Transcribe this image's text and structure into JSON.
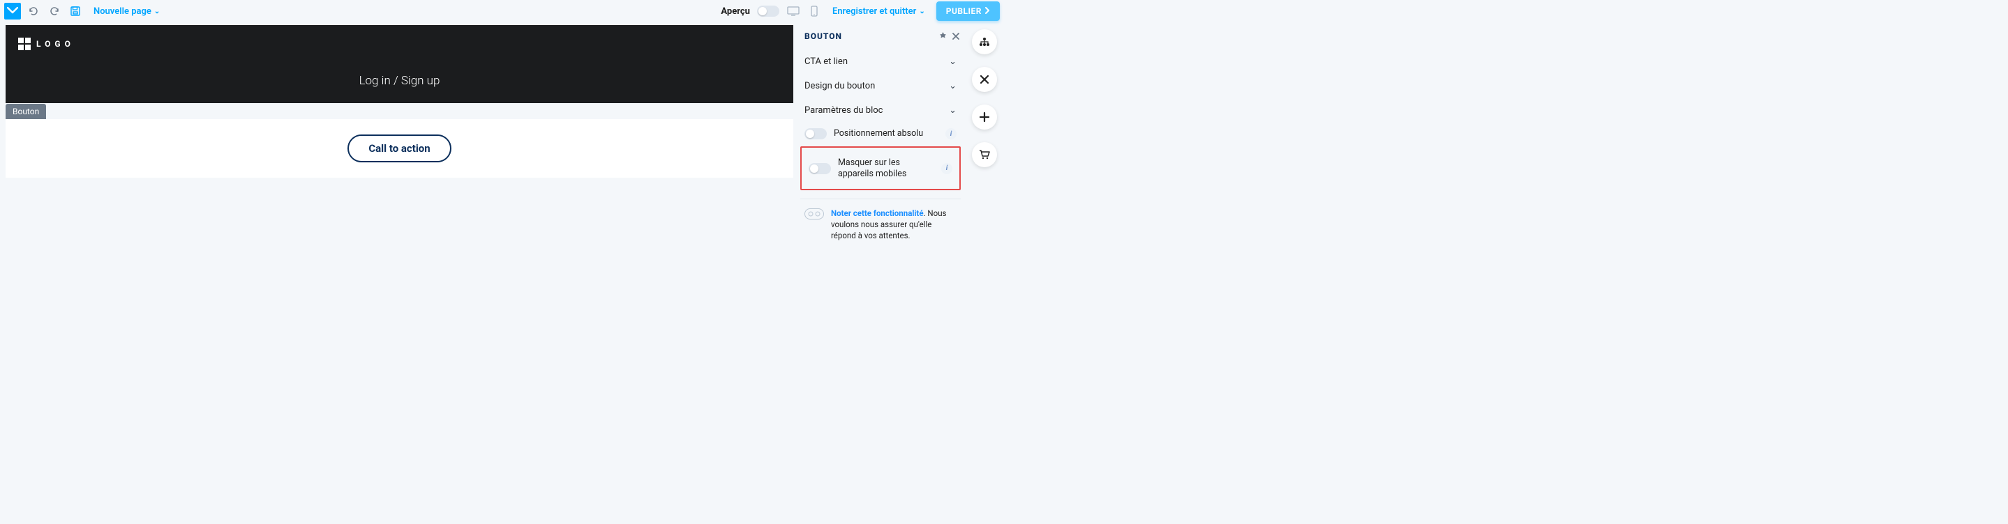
{
  "topbar": {
    "new_page": "Nouvelle page",
    "preview_label": "Aperçu",
    "save_exit": "Enregistrer et quitter",
    "publish": "PUBLIER"
  },
  "canvas": {
    "hero_logo_text": "LOGO",
    "hero_login": "Log in / Sign up",
    "block_tag": "Bouton",
    "cta_text": "Call to action"
  },
  "panel": {
    "title": "BOUTON",
    "sections": {
      "cta_link": "CTA et lien",
      "design": "Design du bouton",
      "block": "Paramètres du bloc"
    },
    "toggles": {
      "absolute": "Positionnement absolu",
      "hide_mobile": "Masquer sur les appareils mobiles"
    },
    "feedback": {
      "link": "Noter cette fonctionnalité",
      "text": ". Nous voulons nous assurer qu'elle répond à vos attentes."
    }
  },
  "icons": {
    "chevron_down": "⌄"
  }
}
